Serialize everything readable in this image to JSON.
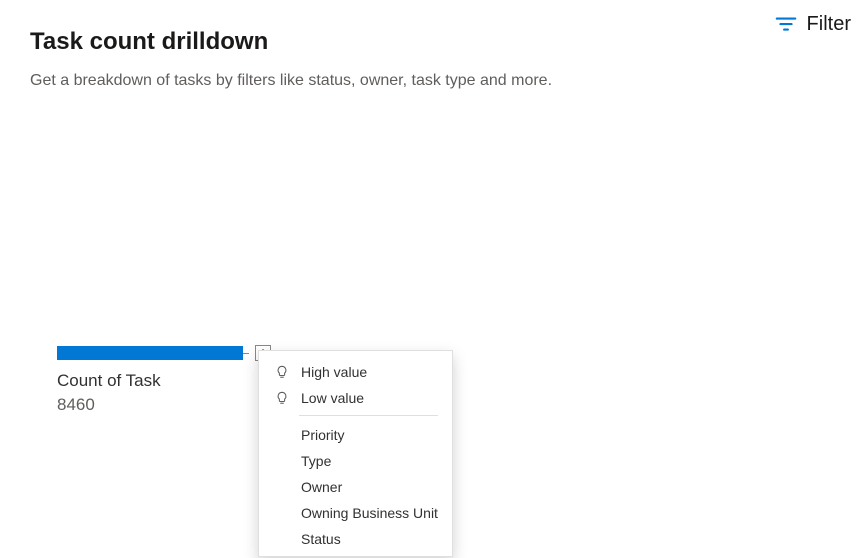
{
  "header": {
    "title": "Task count drilldown",
    "subtitle": "Get a breakdown of tasks by filters like status, owner, task type and more.",
    "filter_label": "Filter"
  },
  "chart_data": {
    "type": "bar",
    "title": "",
    "categories": [
      "Count of Task"
    ],
    "values": [
      8460
    ],
    "xlabel": "",
    "ylabel": "",
    "ylim": [
      0,
      8460
    ]
  },
  "bar": {
    "label": "Count of Task",
    "value": "8460"
  },
  "menu": {
    "smart": [
      {
        "label": "High value"
      },
      {
        "label": "Low value"
      }
    ],
    "fields": [
      {
        "label": "Priority"
      },
      {
        "label": "Type"
      },
      {
        "label": "Owner"
      },
      {
        "label": "Owning Business Unit"
      },
      {
        "label": "Status"
      }
    ]
  }
}
